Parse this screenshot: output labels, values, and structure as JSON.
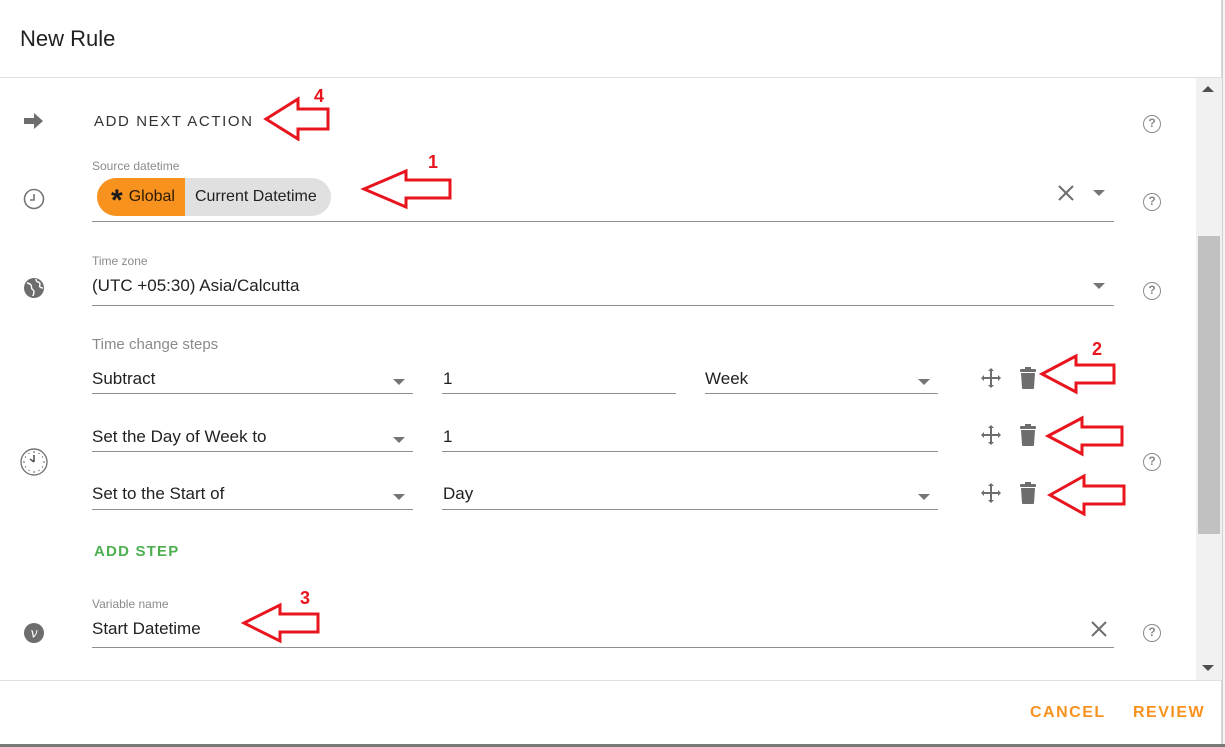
{
  "dialog": {
    "title": "New Rule"
  },
  "action": {
    "label": "ADD NEXT ACTION",
    "icon": "arrow-right-icon"
  },
  "source_datetime": {
    "label": "Source datetime",
    "chip_scope_icon": "asterisk-icon",
    "chip_scope": "Global",
    "chip_value": "Current Datetime",
    "icon": "clock-icon"
  },
  "time_zone": {
    "label": "Time zone",
    "value": "(UTC +05:30) Asia/Calcutta",
    "icon": "globe-icon"
  },
  "time_change_steps": {
    "label": "Time change steps",
    "icon": "clock-face-icon",
    "steps": [
      {
        "operation": "Subtract",
        "amount": "1",
        "unit": "Week"
      },
      {
        "operation": "Set the Day of Week to",
        "value": "1"
      },
      {
        "operation": "Set to the Start of",
        "unit": "Day"
      }
    ],
    "add_step_label": "ADD STEP"
  },
  "variable_name": {
    "label": "Variable name",
    "value": "Start Datetime",
    "icon": "variable-icon"
  },
  "help_icon": "help-circle-icon",
  "footer": {
    "cancel_label": "CANCEL",
    "review_label": "REVIEW"
  },
  "annotations": {
    "arrow_1": "1",
    "arrow_2": "2",
    "arrow_3": "3",
    "arrow_4": "4"
  },
  "colors": {
    "accent": "#f7921e",
    "add_step": "#4caf50",
    "annotation": "#e8141e",
    "chip_bg": "#e0e0e0"
  }
}
